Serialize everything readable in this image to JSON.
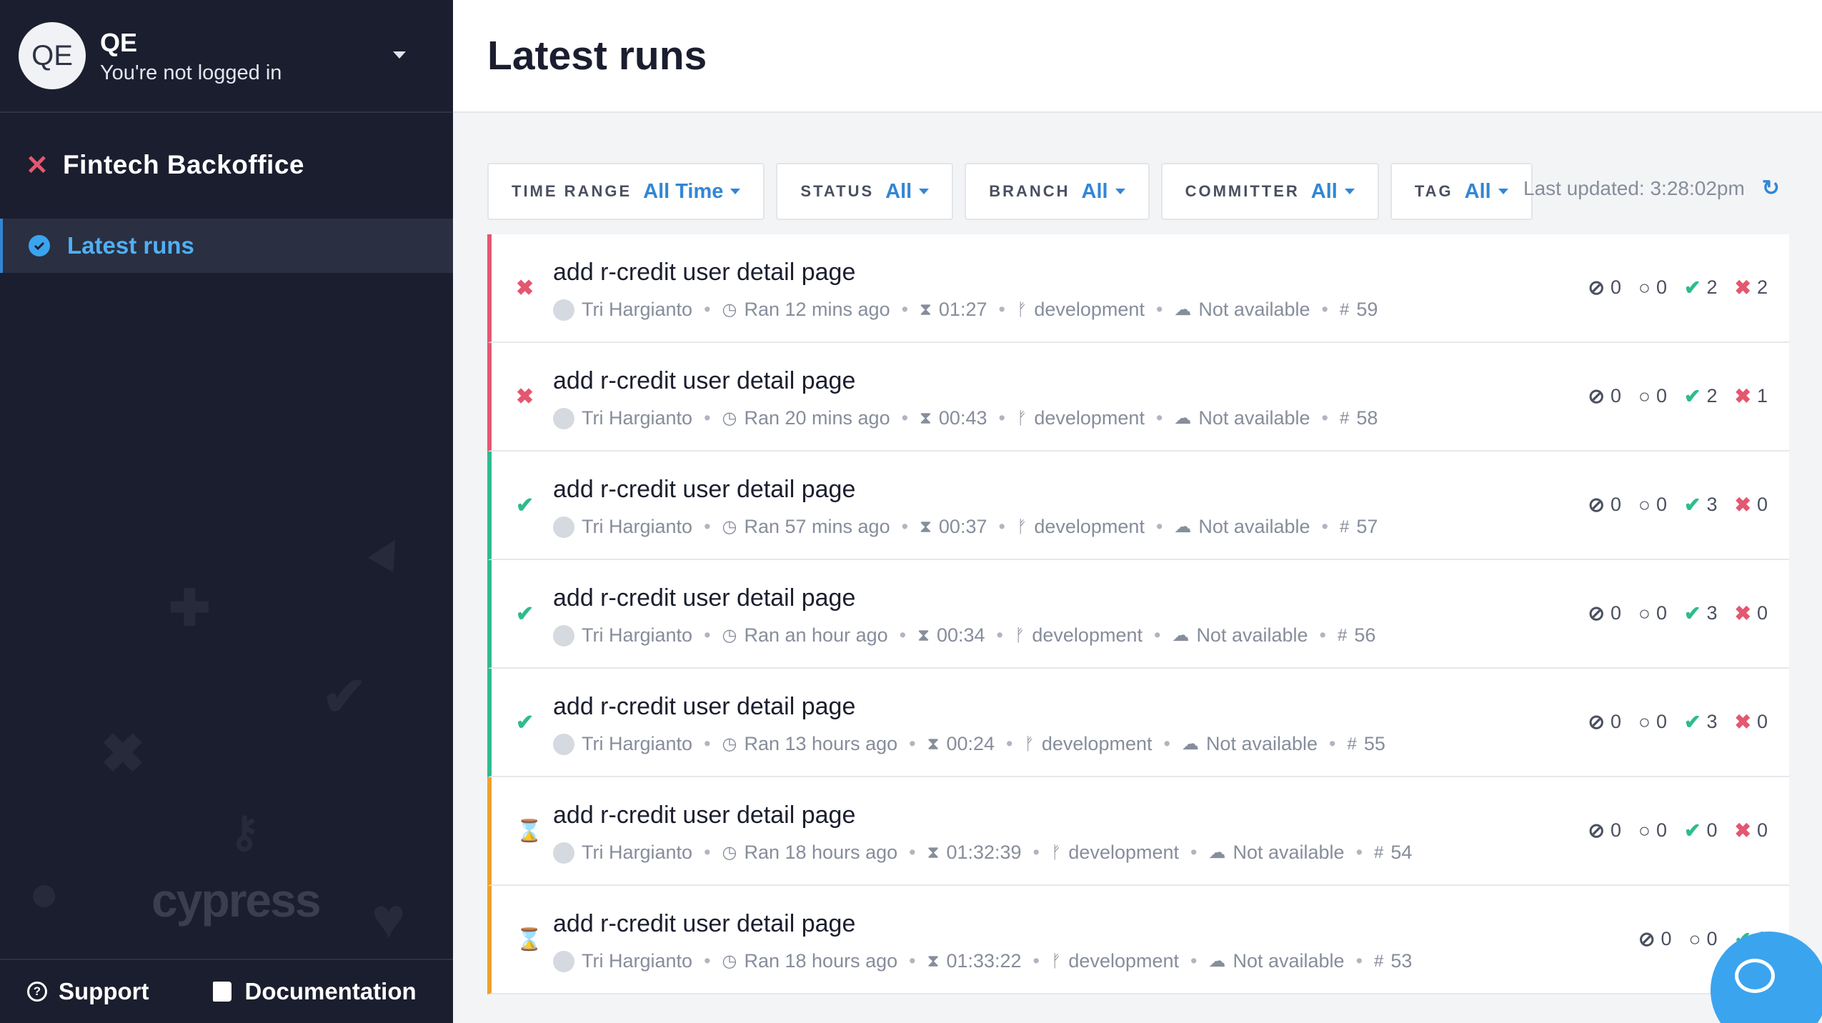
{
  "user": {
    "initials": "QE",
    "name": "QE",
    "status": "You're not logged in"
  },
  "project": {
    "name": "Fintech Backoffice"
  },
  "nav": {
    "latest_runs": "Latest runs"
  },
  "brand": "cypress",
  "footer": {
    "support": "Support",
    "documentation": "Documentation"
  },
  "header": {
    "title": "Latest runs"
  },
  "filters": [
    {
      "label": "TIME RANGE",
      "value": "All Time"
    },
    {
      "label": "STATUS",
      "value": "All"
    },
    {
      "label": "BRANCH",
      "value": "All"
    },
    {
      "label": "COMMITTER",
      "value": "All"
    },
    {
      "label": "TAG",
      "value": "All"
    }
  ],
  "last_updated": "Last updated: 3:28:02pm",
  "runs": [
    {
      "status": "failed",
      "title": "add r-credit user detail page",
      "committer": "Tri Hargianto",
      "ran": "Ran 12 mins ago",
      "duration": "01:27",
      "branch": "development",
      "ci": "Not available",
      "number": "59",
      "skipped": "0",
      "pending": "0",
      "passed": "2",
      "failed": "2"
    },
    {
      "status": "failed",
      "title": "add r-credit user detail page",
      "committer": "Tri Hargianto",
      "ran": "Ran 20 mins ago",
      "duration": "00:43",
      "branch": "development",
      "ci": "Not available",
      "number": "58",
      "skipped": "0",
      "pending": "0",
      "passed": "2",
      "failed": "1"
    },
    {
      "status": "passed",
      "title": "add r-credit user detail page",
      "committer": "Tri Hargianto",
      "ran": "Ran 57 mins ago",
      "duration": "00:37",
      "branch": "development",
      "ci": "Not available",
      "number": "57",
      "skipped": "0",
      "pending": "0",
      "passed": "3",
      "failed": "0"
    },
    {
      "status": "passed",
      "title": "add r-credit user detail page",
      "committer": "Tri Hargianto",
      "ran": "Ran an hour ago",
      "duration": "00:34",
      "branch": "development",
      "ci": "Not available",
      "number": "56",
      "skipped": "0",
      "pending": "0",
      "passed": "3",
      "failed": "0"
    },
    {
      "status": "passed",
      "title": "add r-credit user detail page",
      "committer": "Tri Hargianto",
      "ran": "Ran 13 hours ago",
      "duration": "00:24",
      "branch": "development",
      "ci": "Not available",
      "number": "55",
      "skipped": "0",
      "pending": "0",
      "passed": "3",
      "failed": "0"
    },
    {
      "status": "running",
      "title": "add r-credit user detail page",
      "committer": "Tri Hargianto",
      "ran": "Ran 18 hours ago",
      "duration": "01:32:39",
      "branch": "development",
      "ci": "Not available",
      "number": "54",
      "skipped": "0",
      "pending": "0",
      "passed": "0",
      "failed": "0"
    },
    {
      "status": "running",
      "title": "add r-credit user detail page",
      "committer": "Tri Hargianto",
      "ran": "Ran 18 hours ago",
      "duration": "01:33:22",
      "branch": "development",
      "ci": "Not available",
      "number": "53",
      "skipped": "0",
      "pending": "0",
      "passed": "0",
      "failed": ""
    }
  ]
}
